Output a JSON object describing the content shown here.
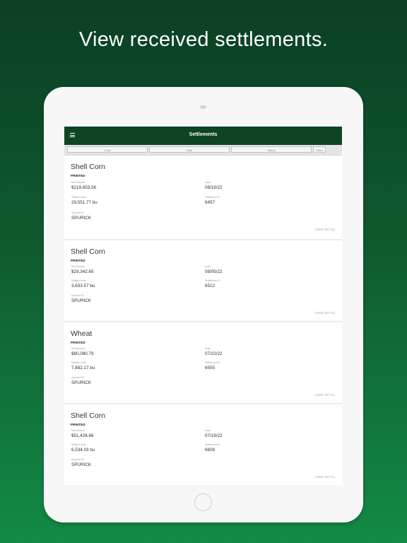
{
  "headline": "View received settlements.",
  "app": {
    "title": "Settlements",
    "filters": [
      "Crop",
      "Date",
      "Status",
      "More"
    ]
  },
  "field_labels": {
    "net_amount": "Net Amount",
    "date": "Date",
    "settled_units": "Settled Units",
    "settlement_no": "Settlement #",
    "account_id": "Account ID"
  },
  "view_detail_label": "VIEW DETAIL",
  "settlements": [
    {
      "crop": "Shell Corn",
      "status": "PRINTED",
      "net_amount": "$219,653.56",
      "date": "08/19/22",
      "settled_units": "29,551.77 bu",
      "settlement_no": "6457",
      "account_id": "SPURICK"
    },
    {
      "crop": "Shell Corn",
      "status": "PRINTED",
      "net_amount": "$29,342.65",
      "date": "08/05/22",
      "settled_units": "3,633.57 bu",
      "settlement_no": "6512",
      "account_id": "SPURICK"
    },
    {
      "crop": "Wheat",
      "status": "PRINTED",
      "net_amount": "$60,080.79",
      "date": "07/22/22",
      "settled_units": "7,882.17 bu",
      "settlement_no": "6555",
      "account_id": "SPURICK"
    },
    {
      "crop": "Shell Corn",
      "status": "PRINTED",
      "net_amount": "$51,426.66",
      "date": "07/19/22",
      "settled_units": "6,534.03 bu",
      "settlement_no": "6608",
      "account_id": "SPURICK"
    }
  ]
}
